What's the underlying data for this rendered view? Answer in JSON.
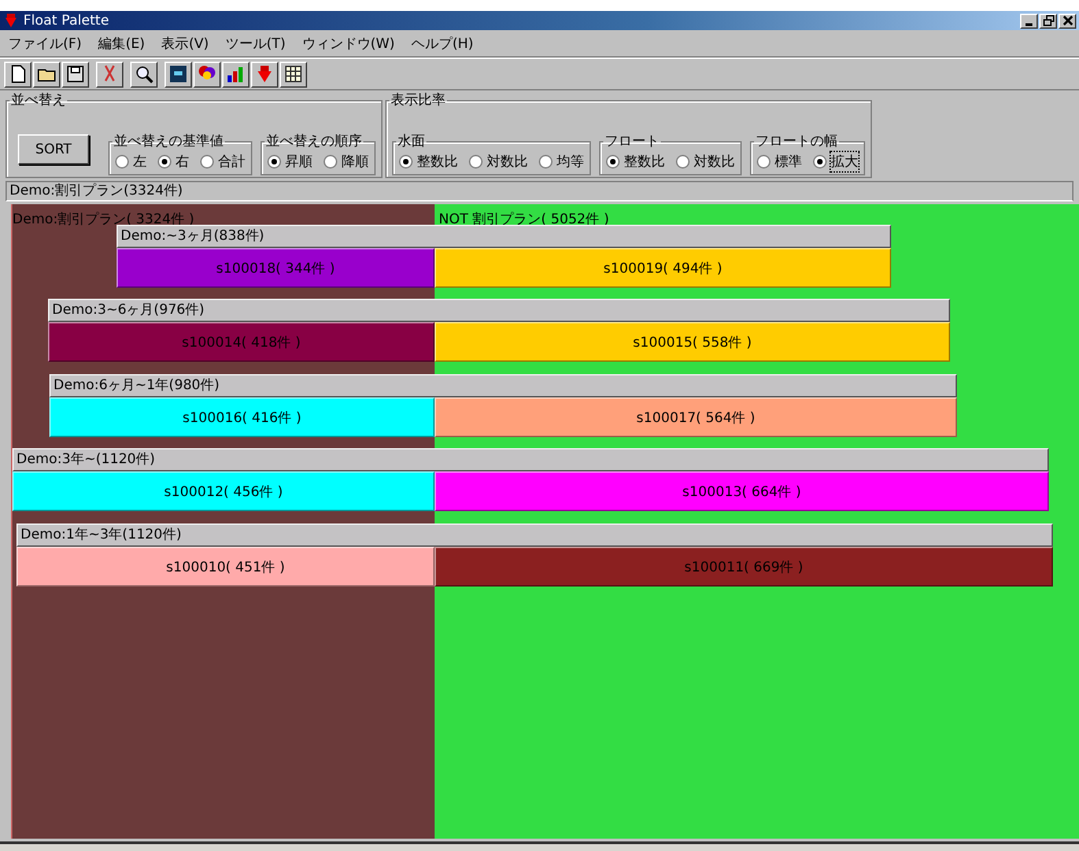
{
  "window": {
    "title": "Float Palette"
  },
  "menu": [
    "ファイル(F)",
    "編集(E)",
    "表示(V)",
    "ツール(T)",
    "ウィンドウ(W)",
    "ヘルプ(H)"
  ],
  "sort_panel": {
    "title": "並べ替え",
    "button": "SORT",
    "groups": [
      {
        "title": "並べ替えの基準値",
        "options": [
          {
            "label": "左",
            "selected": false
          },
          {
            "label": "右",
            "selected": true
          },
          {
            "label": "合計",
            "selected": false
          }
        ]
      },
      {
        "title": "並べ替えの順序",
        "options": [
          {
            "label": "昇順",
            "selected": true
          },
          {
            "label": "降順",
            "selected": false
          }
        ]
      }
    ]
  },
  "ratio_panel": {
    "title": "表示比率",
    "groups": [
      {
        "title": "水面",
        "options": [
          {
            "label": "整数比",
            "selected": true
          },
          {
            "label": "対数比",
            "selected": false
          },
          {
            "label": "均等",
            "selected": false
          }
        ]
      },
      {
        "title": "フロート",
        "options": [
          {
            "label": "整数比",
            "selected": true
          },
          {
            "label": "対数比",
            "selected": false
          }
        ]
      },
      {
        "title": "フロートの幅",
        "options": [
          {
            "label": "標準",
            "selected": false
          },
          {
            "label": "拡大",
            "selected": true
          }
        ]
      }
    ]
  },
  "status_label": "Demo:割引プラン(3324件)",
  "canvas": {
    "segments": [
      {
        "label": "Demo:割引プラン( 3324件 )",
        "color": "#6b3a3a"
      },
      {
        "label": "NOT 割引プラン( 5052件 )",
        "color": "#33dd44"
      }
    ],
    "groups": [
      {
        "header": "Demo:~3ヶ月(838件)",
        "left": {
          "label": "s100018( 344件 )",
          "color": "#9900cc"
        },
        "right": {
          "label": "s100019( 494件 )",
          "color": "#ffcc00"
        }
      },
      {
        "header": "Demo:3~6ヶ月(976件)",
        "left": {
          "label": "s100014( 418件 )",
          "color": "#880044"
        },
        "right": {
          "label": "s100015( 558件 )",
          "color": "#ffcc00"
        }
      },
      {
        "header": "Demo:6ヶ月~1年(980件)",
        "left": {
          "label": "s100016( 416件 )",
          "color": "#00ffff"
        },
        "right": {
          "label": "s100017( 564件 )",
          "color": "#ffa07a"
        }
      },
      {
        "header": "Demo:3年~(1120件)",
        "left": {
          "label": "s100012( 456件 )",
          "color": "#00ffff"
        },
        "right": {
          "label": "s100013( 664件 )",
          "color": "#ff00ff"
        }
      },
      {
        "header": "Demo:1年~3年(1120件)",
        "left": {
          "label": "s100010( 451件 )",
          "color": "#ffaaaa"
        },
        "right": {
          "label": "s100011( 669件 )",
          "color": "#8b2020"
        }
      }
    ]
  }
}
